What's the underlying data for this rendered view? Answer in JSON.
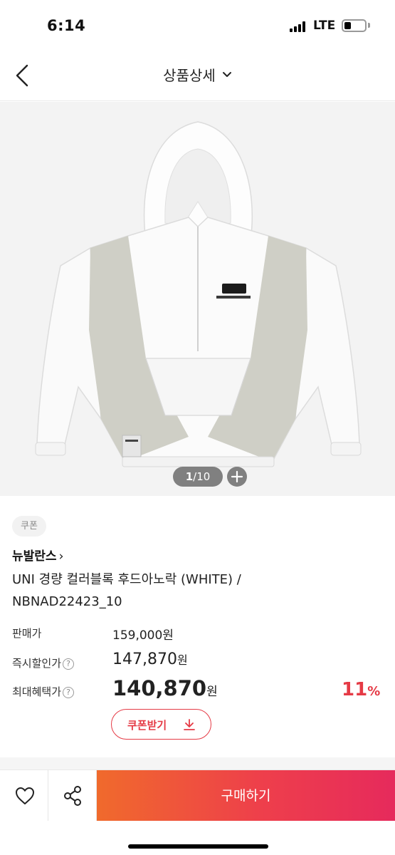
{
  "status_bar": {
    "time": "6:14",
    "network": "LTE",
    "battery_level": 0.3
  },
  "header": {
    "title": "상품상세",
    "back_icon": "chevron-left-icon",
    "dropdown_icon": "chevron-down-icon"
  },
  "gallery": {
    "current": "1",
    "separator": "/",
    "total": "10",
    "plus_icon": "plus-icon",
    "image_description_icon": "jacket-image"
  },
  "product": {
    "coupon_badge": "쿠폰",
    "brand": "뉴발란스",
    "brand_arrow": "›",
    "name": "UNI 경량 컬러블록 후드아노락 (WHITE) / NBNAD22423_10"
  },
  "prices": {
    "sale_label": "판매가",
    "sale_value": "159,000원",
    "instant_label": "즉시할인가",
    "instant_value": "147,870",
    "instant_unit": "원",
    "max_label": "최대혜택가",
    "max_value": "140,870",
    "max_unit": "원",
    "discount_value": "11",
    "discount_unit": "%",
    "info_icon": "question-icon"
  },
  "coupon_button": {
    "label": "쿠폰받기",
    "icon": "download-icon"
  },
  "bottom_bar": {
    "wish_icon": "heart-icon",
    "share_icon": "share-icon",
    "buy_label": "구매하기"
  },
  "colors": {
    "accent_red": "#e53a45",
    "buy_gradient_start": "#f06a2c",
    "buy_gradient_end": "#e62a5c"
  }
}
